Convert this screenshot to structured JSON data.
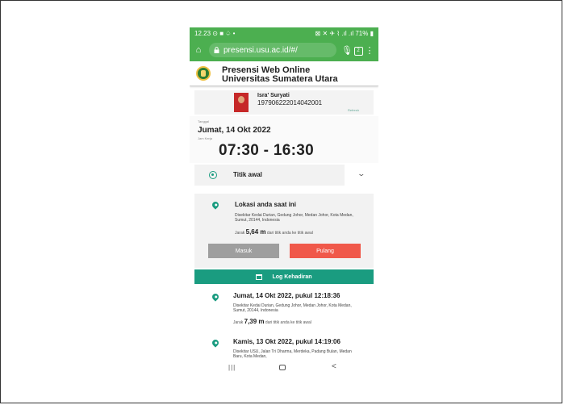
{
  "status_bar": {
    "time": "12.23",
    "left_icons": "⊙ ■ ♤ •",
    "right_icons": "⊠ ✕ ✈ ⌇ .ıl .ıl",
    "battery": "71%"
  },
  "browser": {
    "url": "presensi.usu.ac.id/#/",
    "tab_count": "2"
  },
  "header": {
    "title_line1": "Presensi Web Online",
    "title_line2": "Universitas Sumatera Utara"
  },
  "profile": {
    "name": "Isra' Suryati",
    "nip": "197906222014042001",
    "action": "Refresh"
  },
  "info": {
    "date_label": "Tanggal",
    "date": "Jumat, 14 Okt 2022",
    "hours_label": "Jam Kerja",
    "hours": "07:30 - 16:30"
  },
  "titik_awal": {
    "label": "Titik awal"
  },
  "lokasi": {
    "title": "Lokasi anda saat ini",
    "address": "Disekitar Kedai Durian, Gedung Johor, Medan Johor, Kota Medan, Sumut, 20144, Indonesia",
    "distance_prefix": "Jarak",
    "distance_value": "5,64 m",
    "distance_suffix": "dari titik anda ke titik awal",
    "btn_masuk": "Masuk",
    "btn_pulang": "Pulang"
  },
  "log": {
    "title": "Log Kehadiran",
    "entries": [
      {
        "title": "Jumat, 14 Okt 2022, pukul 12:18:36",
        "address": "Disekitar Kedai Durian, Gedung Johor, Medan Johor, Kota Medan, Sumut, 20144, Indonesia",
        "distance_prefix": "Jarak",
        "distance_value": "7,39 m",
        "distance_suffix": "dari titik anda ke titik awal"
      },
      {
        "title": "Kamis, 13 Okt 2022, pukul 14:19:06",
        "address": "Disekitar USU, Jalan Tri Dharma, Merdeka, Padang Bulan, Medan Baru, Kota Medan,"
      }
    ]
  },
  "colors": {
    "status_green": "#4caf50",
    "teal": "#1a9c80",
    "pulang_red": "#f0584a",
    "masuk_gray": "#9e9e9e"
  },
  "nav_icons": [
    "recents-icon",
    "home-icon",
    "back-icon"
  ]
}
